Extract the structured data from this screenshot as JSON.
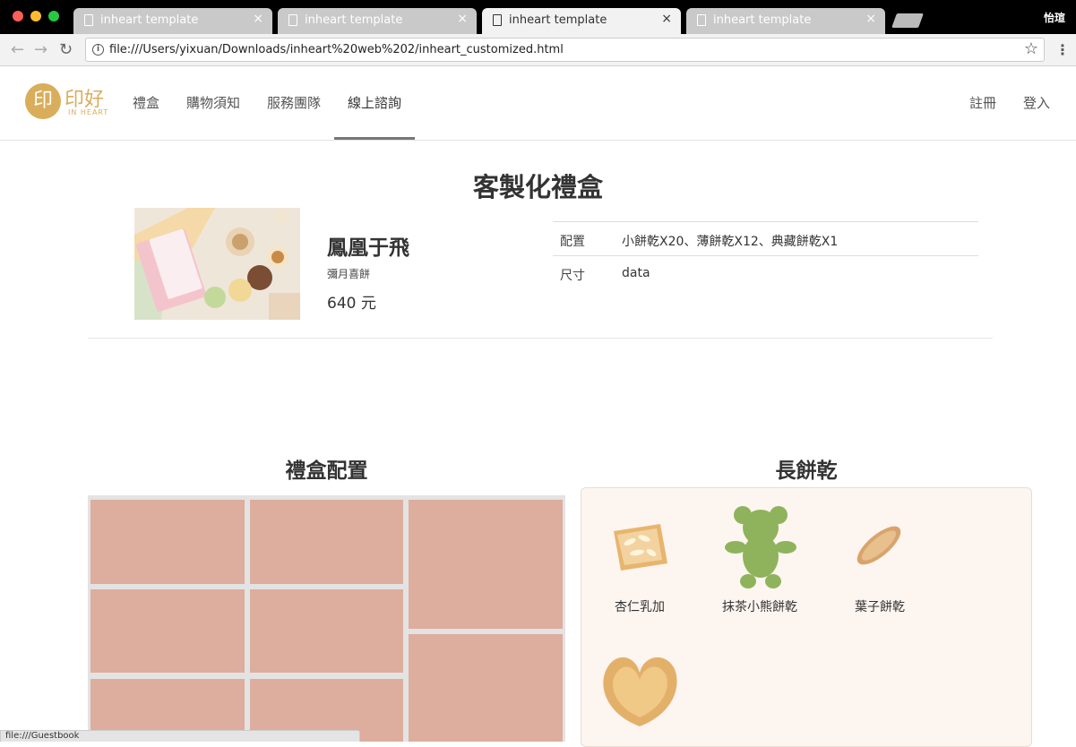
{
  "browser": {
    "tabs": [
      {
        "title": "inheart template"
      },
      {
        "title": "inheart template"
      },
      {
        "title": "inheart template"
      },
      {
        "title": "inheart template"
      }
    ],
    "user": "怡瑄",
    "url": "file:///Users/yixuan/Downloads/inheart%20web%202/inheart_customized.html",
    "status": "file:///Guestbook"
  },
  "header": {
    "logo": {
      "mark": "印",
      "text": "印好",
      "sub": "IN HEART"
    },
    "nav": [
      "禮盒",
      "購物須知",
      "服務團隊",
      "線上諮詢"
    ],
    "active_nav": "線上諮詢",
    "auth": {
      "register": "註冊",
      "login": "登入"
    }
  },
  "main": {
    "title": "客製化禮盒",
    "product": {
      "name": "鳳凰于飛",
      "category": "彌月喜餅",
      "price": "640 元"
    },
    "specs": [
      {
        "key": "配置",
        "value": "小餅乾X20、薄餅乾X12、典藏餅乾X1"
      },
      {
        "key": "尺寸",
        "value": "data"
      }
    ]
  },
  "box_config": {
    "title": "禮盒配置",
    "cell_color": "#ddad9d"
  },
  "cookies": {
    "title": "長餅乾",
    "items": [
      {
        "label": "杏仁乳加"
      },
      {
        "label": "抹茶小熊餅乾"
      },
      {
        "label": "葉子餅乾"
      },
      {
        "label": ""
      }
    ]
  }
}
